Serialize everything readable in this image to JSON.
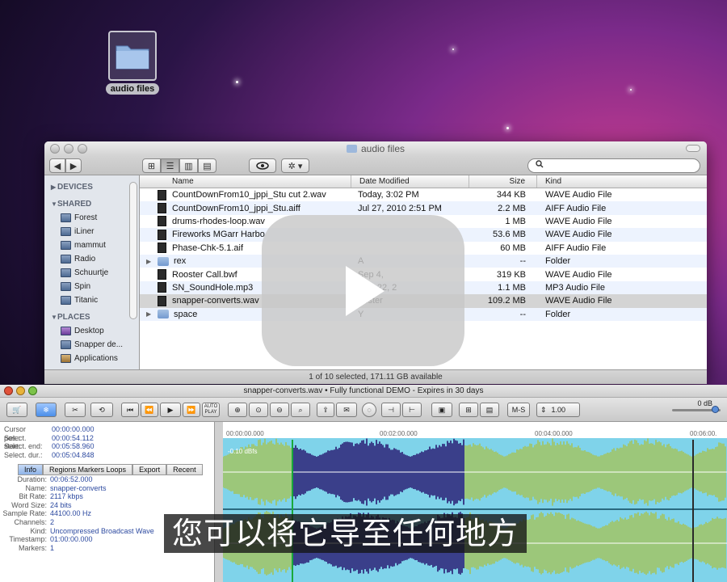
{
  "desktop": {
    "folder_label": "audio files"
  },
  "finder": {
    "title": "audio files",
    "search_placeholder": "",
    "sidebar": {
      "devices_header": "DEVICES",
      "shared_header": "SHARED",
      "places_header": "PLACES",
      "shared_items": [
        "Forest",
        "iLiner",
        "mammut",
        "Radio",
        "Schuurtje",
        "Spin",
        "Titanic"
      ],
      "places_items": [
        "Desktop",
        "Snapper de...",
        "Applications"
      ]
    },
    "columns": {
      "name": "Name",
      "date": "Date Modified",
      "size": "Size",
      "kind": "Kind"
    },
    "rows": [
      {
        "name": "CountDownFrom10_jppi_Stu cut 2.wav",
        "date": "Today, 3:02 PM",
        "size": "344 KB",
        "kind": "WAVE Audio File",
        "type": "file"
      },
      {
        "name": "CountDownFrom10_jppi_Stu.aiff",
        "date": "Jul 27, 2010 2:51 PM",
        "size": "2.2 MB",
        "kind": "AIFF Audio File",
        "type": "file"
      },
      {
        "name": "drums-rhodes-loop.wav",
        "date": "",
        "size": "1 MB",
        "kind": "WAVE Audio File",
        "type": "file"
      },
      {
        "name": "Fireworks MGarr Harbo",
        "date": "",
        "size": "53.6 MB",
        "kind": "WAVE Audio File",
        "type": "file"
      },
      {
        "name": "Phase-Chk-5.1.aif",
        "date": "",
        "size": "60 MB",
        "kind": "AIFF Audio File",
        "type": "file"
      },
      {
        "name": "rex",
        "date": "A",
        "size": "--",
        "kind": "Folder",
        "type": "folder"
      },
      {
        "name": "Rooster Call.bwf",
        "date": "Sep 4,",
        "size": "319 KB",
        "kind": "WAVE Audio File",
        "type": "file"
      },
      {
        "name": "SN_SoundHole.mp3",
        "date": "May 22, 2",
        "size": "1.1 MB",
        "kind": "MP3 Audio File",
        "type": "file"
      },
      {
        "name": "snapper-converts.wav",
        "date": "Yester",
        "size": "109.2 MB",
        "kind": "WAVE Audio File",
        "type": "file"
      },
      {
        "name": "space",
        "date": "Y",
        "size": "--",
        "kind": "Folder",
        "type": "folder"
      }
    ],
    "status": "1 of 10 selected, 171.11 GB available"
  },
  "editor": {
    "title": "snapper-converts.wav • Fully functional DEMO - Expires in 30 days",
    "zero_db": "0 dB",
    "playback_rate": "1.00",
    "ms_label": "M-S",
    "auto_play": "AUTO PLAY",
    "cursor": {
      "cursor_pos_label": "Cursor pos.:",
      "cursor_pos": "00:00:00.000",
      "select_start_label": "Select. start:",
      "select_start": "00:00:54.112",
      "select_end_label": "Select. end:",
      "select_end": "00:05:58.960",
      "select_dur_label": "Select. dur.:",
      "select_dur": "00:05:04.848"
    },
    "tabs": [
      "Info",
      "Regions Markers Loops",
      "Export",
      "Recent"
    ],
    "info": [
      {
        "k": "Duration:",
        "v": "00:06:52.000"
      },
      {
        "k": "Name:",
        "v": "snapper-converts"
      },
      {
        "k": "Bit Rate:",
        "v": "2117 kbps"
      },
      {
        "k": "Word Size:",
        "v": "24 bits"
      },
      {
        "k": "Sample Rate:",
        "v": "44100.00 Hz"
      },
      {
        "k": "Channels:",
        "v": "2"
      },
      {
        "k": "Kind:",
        "v": "Uncompressed Broadcast Wave"
      },
      {
        "k": "Timestamp:",
        "v": "01:00:00.000"
      },
      {
        "k": "Markers:",
        "v": "1"
      }
    ],
    "ruler": [
      "00:00:00.000",
      "00:02:00.000",
      "00:04:00.000",
      "00:06:00."
    ],
    "peak_label": "-0.10 dBfs"
  },
  "subtitle": "您可以将它导至任何地方",
  "colors": {
    "wave_fill": "#7fd3ea",
    "wave_selected": "#3a3f8a",
    "wave_unselected": "#9cc77a",
    "selected_row": "#d4d4d4"
  }
}
